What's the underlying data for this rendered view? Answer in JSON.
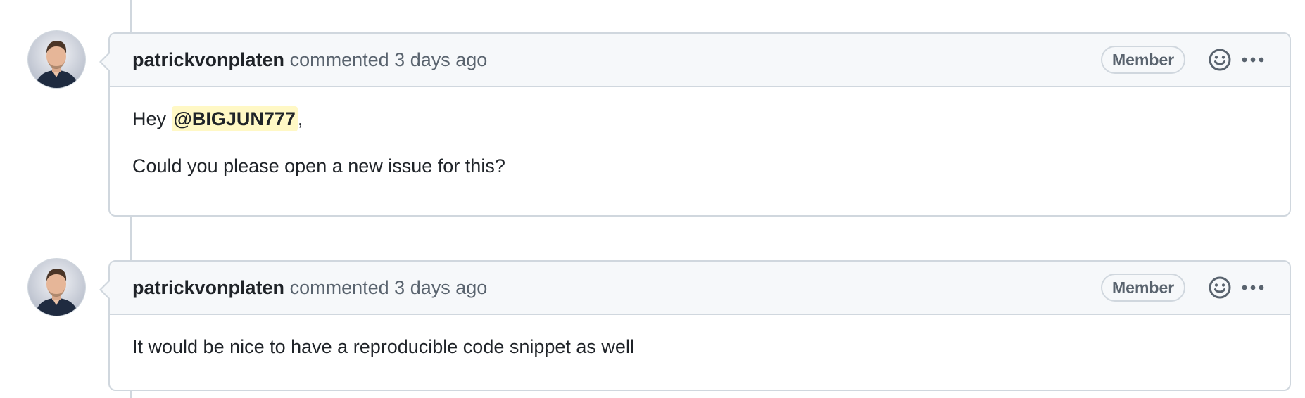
{
  "comments": [
    {
      "author": "patrickvonplaten",
      "action": "commented",
      "timestamp": "3 days ago",
      "role_badge": "Member",
      "avatar_icon": "user-avatar-photo",
      "reaction_icon": "smiley-icon",
      "more_icon": "kebab-horizontal-icon",
      "body": {
        "greeting_prefix": "Hey",
        "mention": "@BIGJUN777",
        "greeting_suffix": ",",
        "paragraph": "Could you please open a new issue for this?"
      }
    },
    {
      "author": "patrickvonplaten",
      "action": "commented",
      "timestamp": "3 days ago",
      "role_badge": "Member",
      "avatar_icon": "user-avatar-photo",
      "reaction_icon": "smiley-icon",
      "more_icon": "kebab-horizontal-icon",
      "body": {
        "paragraph": "It would be nice to have a reproducible code snippet as well"
      }
    }
  ],
  "colors": {
    "border": "#d0d7de",
    "header_bg": "#f6f8fa",
    "muted_text": "#59636e",
    "mention_bg": "#fff8c5"
  }
}
